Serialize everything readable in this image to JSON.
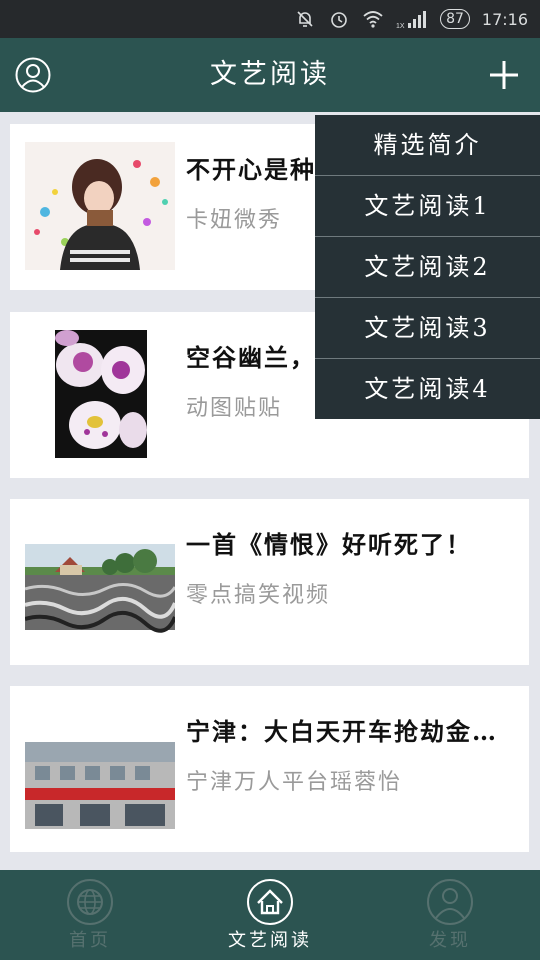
{
  "status_bar": {
    "battery": "87",
    "time": "17:16",
    "icons": [
      "mute-bell-icon",
      "alarm-icon",
      "wifi-icon",
      "signal-icon"
    ],
    "network": "1X"
  },
  "app_bar": {
    "title": "文艺阅读",
    "left_icon": "profile-icon",
    "right_icon": "plus-icon",
    "color": "#2c5451"
  },
  "articles": [
    {
      "title": "不开心是种",
      "source": "卡妞微秀"
    },
    {
      "title": "空谷幽兰，",
      "source": "动图贴贴"
    },
    {
      "title": "一首《情恨》好听死了！",
      "source": "零点搞笑视频"
    },
    {
      "title": "宁津：大白天开车抢劫金…",
      "source": "宁津万人平台瑶蓉怡"
    }
  ],
  "dropdown_menu": {
    "items": [
      "精选简介",
      "文艺阅读1",
      "文艺阅读2",
      "文艺阅读3",
      "文艺阅读4"
    ]
  },
  "bottom_nav": {
    "items": [
      {
        "label": "首页",
        "icon": "globe-icon"
      },
      {
        "label": "文艺阅读",
        "icon": "home-icon"
      },
      {
        "label": "发现",
        "icon": "profile-icon"
      }
    ],
    "active_index": 1
  }
}
